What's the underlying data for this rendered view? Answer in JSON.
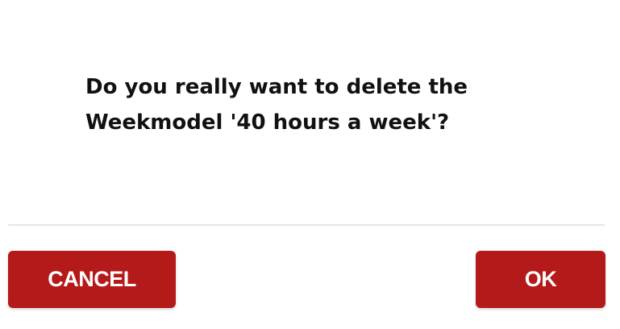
{
  "dialog": {
    "message_line1": "Do you really want to delete the",
    "message_line2": "Weekmodel '40 hours a week'?",
    "cancel_label": "CANCEL",
    "ok_label": "OK"
  },
  "colors": {
    "button_bg": "#b51a1a",
    "button_text": "#ffffff",
    "divider": "#e2e6ea",
    "message_text": "#111111"
  }
}
